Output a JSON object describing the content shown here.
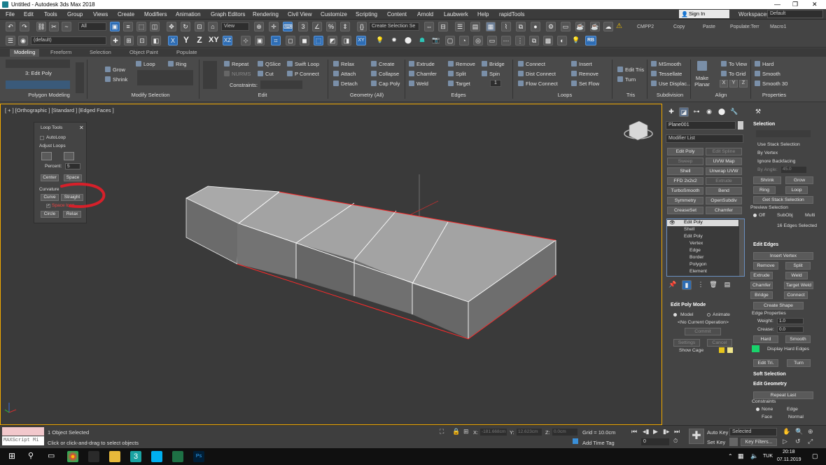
{
  "window": {
    "title": "Untitled - Autodesk 3ds Max 2018",
    "minimize": "—",
    "restore": "❐",
    "close": "✕"
  },
  "menu": [
    "File",
    "Edit",
    "Tools",
    "Group",
    "Views",
    "Create",
    "Modifiers",
    "Animation",
    "Graph Editors",
    "Rendering",
    "Civil View",
    "Customize",
    "Scripting",
    "Content",
    "Arnold",
    "Laubwerk",
    "Help",
    "rapidTools"
  ],
  "account": {
    "sign_in": "Sign In",
    "workspaces_label": "Workspaces:",
    "workspace": "Default"
  },
  "toolbar": {
    "filter": "All",
    "layer": "(default)",
    "ref_coord": "View",
    "selection_set": "Create Selection Se",
    "right_buttons": [
      "CMPP2",
      "Copy",
      "Paste",
      "Populate:Terr",
      "Macro1"
    ],
    "rb_label": "RB"
  },
  "ribbon_tabs": [
    "Modeling",
    "Freeform",
    "Selection",
    "Object Paint",
    "Populate"
  ],
  "ribbon": {
    "edit_poly": "3: Edit Poly",
    "grow": "Grow",
    "shrink": "Shrink",
    "loop": "Loop",
    "ring": "Ring",
    "repeat": "Repeat",
    "nurms": "NURMS",
    "qslice": "QSlice",
    "cut": "Cut",
    "swift_loop": "Swift Loop",
    "p_connect": "P Connect",
    "constraints": "Constraints:",
    "relax": "Relax",
    "attach": "Attach",
    "detach": "Detach",
    "create": "Create",
    "collapse": "Collapse",
    "cap_poly": "Cap Poly",
    "extrude": "Extrude",
    "chamfer": "Chamfer",
    "weld": "Weld",
    "remove": "Remove",
    "split": "Split",
    "target": "Target",
    "bridge": "Bridge",
    "spin": "Spin",
    "spin_val": "1",
    "connect": "Connect",
    "dist_connect": "Dist Connect",
    "flow_connect": "Flow Connect",
    "insert": "Insert",
    "remove2": "Remove",
    "set_flow": "Set Flow",
    "edit_tris": "Edit Tris",
    "turn": "Turn",
    "msmooth": "MSmooth",
    "tessellate": "Tessellate",
    "use_displac": "Use Displac...",
    "make_planar": "Make Planar",
    "to_view": "To View",
    "to_grid": "To Grid",
    "x": "X",
    "y": "Y",
    "z": "Z",
    "hard": "Hard",
    "smooth": "Smooth",
    "smooth30": "Smooth 30",
    "groups": [
      "Polygon Modeling",
      "Modify Selection",
      "Edit",
      "Geometry (All)",
      "Edges",
      "Loops",
      "Tris",
      "Subdivision",
      "Align",
      "Properties"
    ]
  },
  "viewport": {
    "label": "[ + ] [Orthographic ] [Standard ] [Edged Faces ]"
  },
  "loop_tools": {
    "title": "Loop Tools",
    "close": "✕",
    "autoloop": "AutoLoop",
    "adjust_loops": "Adjust Loops",
    "percent_label": "Percent:",
    "percent": "5",
    "center": "Center",
    "space": "Space",
    "curvature": "Curvature",
    "curve": "Curve",
    "straight": "Straight",
    "space_loop": "Space loop",
    "circle": "Circle",
    "relax": "Relax"
  },
  "command_panel": {
    "object_name": "Plane001",
    "modifier_list": "Modifier List",
    "modifier_buttons": [
      [
        "Edit Poly",
        "Edit Spline"
      ],
      [
        "Sweep",
        "UVW Map"
      ],
      [
        "Shell",
        "Unwrap UVW"
      ],
      [
        "FFD 2x2x2",
        "Extrude"
      ],
      [
        "TurboSmooth",
        "Bend"
      ],
      [
        "Symmetry",
        "OpenSubdiv"
      ],
      [
        "CreaseSet",
        "Chamfer"
      ]
    ],
    "stack": [
      "Edit Poly",
      "Shell",
      "Edit Poly",
      "Vertex",
      "Edge",
      "Border",
      "Polygon",
      "Element"
    ],
    "edit_poly_mode": "Edit Poly Mode",
    "model": "Model",
    "animate": "Animate",
    "no_op": "<No Current Operation>",
    "commit": "Commit",
    "settings": "Settings",
    "cancel": "Cancel",
    "show_cage": "Show Cage"
  },
  "selection_rollout": {
    "title": "Selection",
    "use_stack": "Use Stack Selection",
    "by_vertex": "By Vertex",
    "ignore_backfacing": "Ignore Backfacing",
    "by_angle": "By Angle:",
    "angle": "45.0",
    "shrink": "Shrink",
    "grow": "Grow",
    "ring": "Ring",
    "loop": "Loop",
    "get_stack": "Get Stack Selection",
    "preview": "Preview Selection",
    "off": "Off",
    "subobj": "SubObj",
    "multi": "Multi",
    "status": "16 Edges Selected"
  },
  "edit_edges": {
    "title": "Edit Edges",
    "insert_vertex": "Insert Vertex",
    "remove": "Remove",
    "split": "Split",
    "extrude": "Extrude",
    "weld": "Weld",
    "chamfer": "Chamfer",
    "target_weld": "Target Weld",
    "bridge": "Bridge",
    "connect": "Connect",
    "create_shape": "Create Shape",
    "edge_props": "Edge Properties",
    "weight_label": "Weight:",
    "weight": "1.0",
    "crease_label": "Crease:",
    "crease": "0.0",
    "hard": "Hard",
    "smooth": "Smooth",
    "display_hard": "Display Hard Edges",
    "edit_tri": "Edit Tri.",
    "turn": "Turn"
  },
  "soft_selection": "Soft Selection",
  "edit_geometry": {
    "title": "Edit Geometry",
    "repeat_last": "Repeat Last",
    "constraints": "Constraints",
    "none": "None",
    "edge": "Edge",
    "face": "Face",
    "normal": "Normal"
  },
  "status": {
    "maxscript": "MAXScript Mi",
    "selected": "1 Object Selected",
    "hint": "Click or click-and-drag to select objects",
    "x_label": "X:",
    "x": "-181.668cm",
    "y_label": "Y:",
    "y": "12.623cm",
    "z_label": "Z:",
    "z": "0.0cm",
    "grid": "Grid = 10.0cm",
    "add_time_tag": "Add Time Tag",
    "auto_key": "Auto Key",
    "selected_dd": "Selected",
    "set_key": "Set Key",
    "key_filters": "Key Filters...",
    "frame": "0"
  },
  "taskbar": {
    "time": "20:18",
    "date": "07.11.2019",
    "lang": "TUK"
  },
  "colors": {
    "accent": "#2e6db4",
    "viewport_border": "#f2a900",
    "selected_edge": "#ff2a2a",
    "annotation": "#d6202a"
  }
}
